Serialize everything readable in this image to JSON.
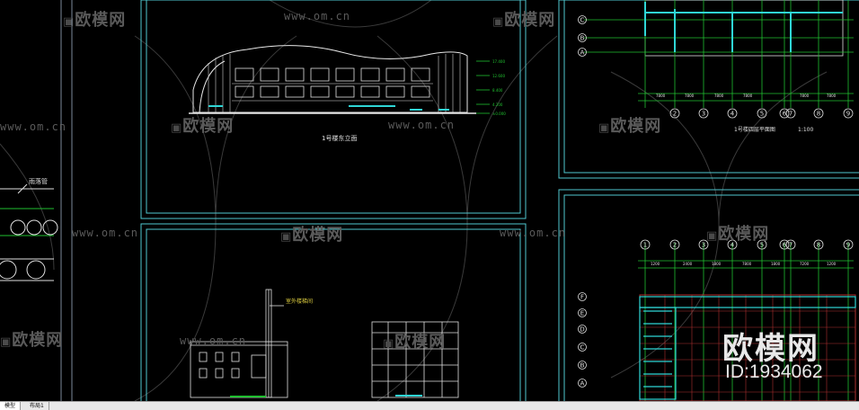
{
  "watermarks": {
    "logo_text": "欧模网",
    "url_text": "www.om.cn"
  },
  "corner": {
    "brand": "欧模网",
    "id_label": "ID:1934062"
  },
  "drawings": {
    "east_elevation_title": "1号楼东立面",
    "plan_title": "1号楼四层平面图",
    "plan_scale": "1:100",
    "rainwater_label": "雨落管",
    "tower_label": "室外楼梯间",
    "axis_numbers_top": [
      "2",
      "3",
      "4",
      "5",
      "6",
      "7",
      "8",
      "9"
    ],
    "axis_numbers_bottom": [
      "1",
      "2",
      "3",
      "4",
      "5",
      "6",
      "7",
      "8",
      "9"
    ],
    "axis_letters_top": [
      "C",
      "B",
      "A"
    ],
    "axis_letters_bottom": [
      "F",
      "E",
      "D",
      "C",
      "B",
      "A"
    ]
  },
  "tabs": [
    {
      "label": "模型",
      "active": true
    },
    {
      "label": "布局1",
      "active": false
    }
  ]
}
